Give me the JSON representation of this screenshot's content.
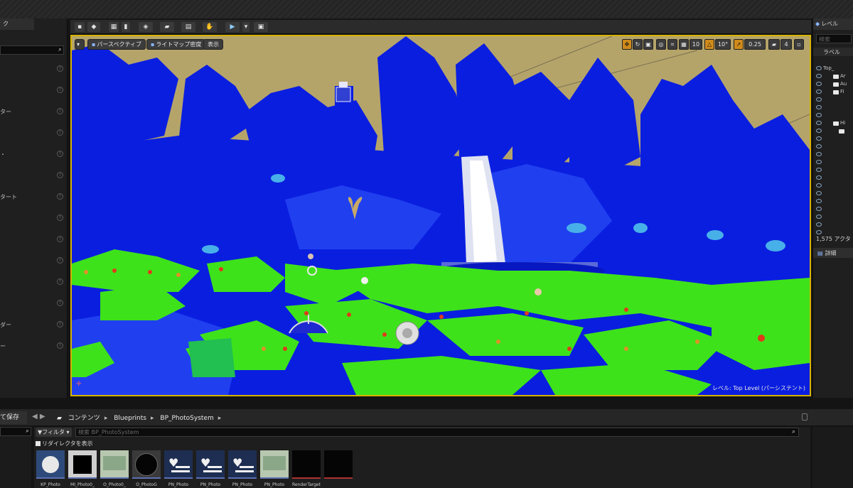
{
  "left_panel": {
    "tab_label": "ク",
    "items": [
      {
        "label": ""
      },
      {
        "label": ""
      },
      {
        "label": "ター"
      },
      {
        "label": ""
      },
      {
        "label": "・"
      },
      {
        "label": ""
      },
      {
        "label": "タート"
      },
      {
        "label": ""
      },
      {
        "label": ""
      },
      {
        "label": ""
      },
      {
        "label": ""
      },
      {
        "label": ""
      },
      {
        "label": "ダー"
      },
      {
        "label": "ー"
      }
    ]
  },
  "viewport": {
    "perspective_label": "パースペクティブ",
    "lightmap_label": "ライトマップ密度",
    "show_label": "表示",
    "grid_snap": "10",
    "rotate_snap": "10°",
    "scale_snap": "0.25",
    "camera_speed": "4",
    "status_text": "レベル: Top Level (パーシステント)"
  },
  "outliner": {
    "tab_label": "レベル",
    "search_placeholder": "検索",
    "column_label": "ラベル",
    "rows": [
      {
        "name": "Top_",
        "indent": 14,
        "folder": false
      },
      {
        "name": "Ar",
        "indent": 28,
        "folder": true
      },
      {
        "name": "Au",
        "indent": 28,
        "folder": true
      },
      {
        "name": "Fi",
        "indent": 28,
        "folder": true
      },
      {
        "name": "",
        "indent": 40,
        "folder": false
      },
      {
        "name": "",
        "indent": 40,
        "folder": false
      },
      {
        "name": "",
        "indent": 40,
        "folder": false
      },
      {
        "name": "Hi",
        "indent": 28,
        "folder": true
      },
      {
        "name": "",
        "indent": 36,
        "folder": true
      },
      {
        "name": "",
        "indent": 40,
        "folder": false
      },
      {
        "name": "",
        "indent": 40,
        "folder": false
      },
      {
        "name": "",
        "indent": 40,
        "folder": false
      },
      {
        "name": "",
        "indent": 40,
        "folder": false
      },
      {
        "name": "",
        "indent": 40,
        "folder": false
      },
      {
        "name": "",
        "indent": 40,
        "folder": false
      },
      {
        "name": "",
        "indent": 40,
        "folder": false
      },
      {
        "name": "",
        "indent": 40,
        "folder": false
      },
      {
        "name": "",
        "indent": 40,
        "folder": false
      },
      {
        "name": "",
        "indent": 40,
        "folder": false
      },
      {
        "name": "",
        "indent": 40,
        "folder": false
      },
      {
        "name": "",
        "indent": 40,
        "folder": false
      },
      {
        "name": "",
        "indent": 40,
        "folder": false
      }
    ],
    "actor_count": "1,575 アクタ",
    "details_tab": "詳細"
  },
  "content_browser": {
    "save_all": "て保存",
    "breadcrumb": [
      "コンテンツ",
      "Blueprints",
      "BP_PhotoSystem"
    ],
    "filter_label": "フィルタ",
    "search_placeholder": "検索 BP_PhotoSystem",
    "redirect_label": "リダイレクタを表示",
    "assets": [
      {
        "name": "KP_Photo",
        "kind": "sphere"
      },
      {
        "name": "MI_Photo0_",
        "kind": "black-square"
      },
      {
        "name": "O_Photo0_",
        "kind": "scene"
      },
      {
        "name": "O_PhotoG",
        "kind": "circle"
      },
      {
        "name": "PN_Photo",
        "kind": "heart"
      },
      {
        "name": "PN_Photo",
        "kind": "heart"
      },
      {
        "name": "PN_Photo",
        "kind": "heart"
      },
      {
        "name": "PN_Photo",
        "kind": "scene"
      },
      {
        "name": "RenderTarget",
        "kind": "black"
      },
      {
        "name": "",
        "kind": "black"
      }
    ]
  },
  "colors": {
    "accent": "#d6b200",
    "sky": "#b5a46a",
    "blue_shade": "#0a1ee0",
    "green_shade": "#3ee21a"
  }
}
